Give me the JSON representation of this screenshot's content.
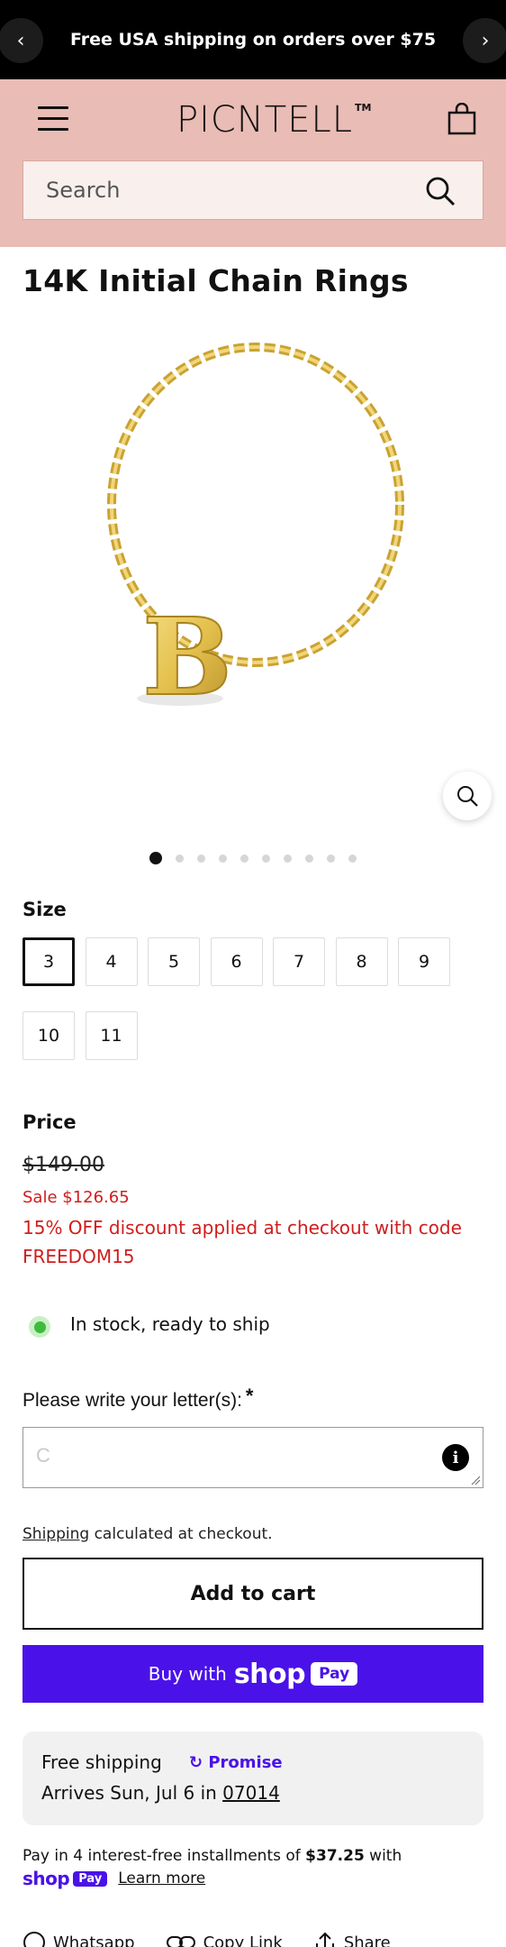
{
  "announcement": {
    "text": "Free USA shipping on orders over $75",
    "prev_arrow": "‹",
    "next_arrow": "›"
  },
  "header": {
    "logo_text": "PICNTELL",
    "logo_tm": "TM",
    "menu_icon": "hamburger-menu-icon",
    "cart_icon": "shopping-bag-icon",
    "search_placeholder": "Search",
    "brand_color": "#e9bcb5"
  },
  "product": {
    "title": "14K Initial Chain Rings",
    "image_letter": "B",
    "gallery_count": 10,
    "gallery_active_index": 0
  },
  "size": {
    "label": "Size",
    "options": [
      "3",
      "4",
      "5",
      "6",
      "7",
      "8",
      "9",
      "10",
      "11"
    ],
    "selected": "3"
  },
  "price": {
    "label": "Price",
    "original": "$149.00",
    "sale": "Sale $126.65",
    "discount_note": "15% OFF discount applied at checkout with code FREEDOM15",
    "sale_color": "#d11d1d"
  },
  "stock": {
    "text": "In stock, ready to ship",
    "status_color": "#3dbb3a"
  },
  "custom_letter": {
    "label": "Please write your letter(s):",
    "required_mark": "*",
    "placeholder": "C",
    "info_icon": "i"
  },
  "shipping_note": {
    "link": "Shipping",
    "rest": " calculated at checkout."
  },
  "buttons": {
    "add_to_cart": "Add to cart",
    "buy_with": "Buy with",
    "shop": "shop",
    "pay": "Pay",
    "shop_pay_color": "#4a12e8"
  },
  "promise": {
    "free_shipping": "Free shipping",
    "badge": "Promise",
    "arrives_prefix": "Arrives Sun, Jul 6 in ",
    "zip": "07014"
  },
  "installments": {
    "prefix": "Pay in 4 interest-free installments of ",
    "amount": "$37.25",
    "suffix": " with",
    "shop": "shop",
    "pay": "Pay",
    "learn_more": "Learn more"
  },
  "social": {
    "whatsapp": "Whatsapp",
    "copy_link": "Copy Link",
    "share": "Share"
  }
}
